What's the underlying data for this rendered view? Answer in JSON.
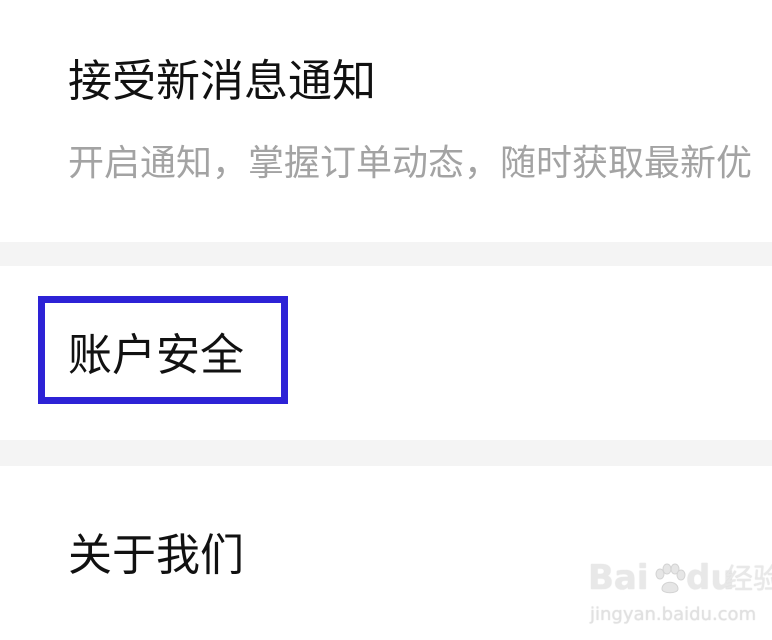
{
  "settings": {
    "notifications": {
      "title": "接受新消息通知",
      "description": "开启通知，掌握订单动态，随时获取最新优"
    },
    "account_security": {
      "title": "账户安全"
    },
    "about": {
      "title": "关于我们"
    }
  },
  "colors": {
    "highlight_border": "#2d22d6",
    "divider": "#f4f4f4",
    "title_text": "#111111",
    "description_text": "#a3a3a3"
  },
  "watermark": {
    "brand": "Bai",
    "brand_suffix": "du",
    "product": "经验",
    "url": "jingyan.baidu.com"
  }
}
